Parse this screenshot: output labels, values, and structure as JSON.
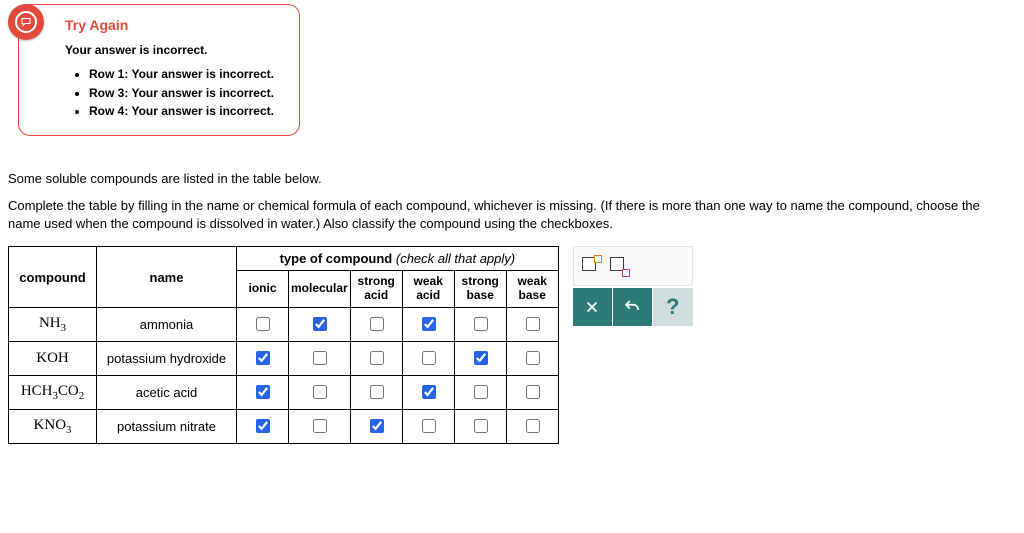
{
  "feedback": {
    "title": "Try Again",
    "subtitle": "Your answer is incorrect.",
    "items": [
      "Row 1: Your answer is incorrect.",
      "Row 3: Your answer is incorrect.",
      "Row 4: Your answer is incorrect."
    ]
  },
  "instructions": {
    "p1": "Some soluble compounds are listed in the table below.",
    "p2": "Complete the table by filling in the name or chemical formula of each compound, whichever is missing. (If there is more than one way to name the compound, choose the name used when the compound is dissolved in water.) Also classify the compound using the checkboxes."
  },
  "table": {
    "headers": {
      "compound": "compound",
      "name": "name",
      "type_group": "type of compound",
      "type_group_hint": "(check all that apply)",
      "cols": {
        "ionic": "ionic",
        "molecular": "molecular",
        "strong_acid_1": "strong",
        "strong_acid_2": "acid",
        "weak_acid_1": "weak",
        "weak_acid_2": "acid",
        "strong_base_1": "strong",
        "strong_base_2": "base",
        "weak_base_1": "weak",
        "weak_base_2": "base"
      }
    },
    "rows": [
      {
        "formula_html": "NH<sub>3</sub>",
        "name": "ammonia",
        "checks": {
          "ionic": false,
          "molecular": true,
          "strong_acid": false,
          "weak_acid": true,
          "strong_base": false,
          "weak_base": false
        }
      },
      {
        "formula_html": "KOH",
        "name": "potassium hydroxide",
        "checks": {
          "ionic": true,
          "molecular": false,
          "strong_acid": false,
          "weak_acid": false,
          "strong_base": true,
          "weak_base": false
        }
      },
      {
        "formula_html": "HCH<sub>3</sub>CO<sub>2</sub>",
        "name": "acetic acid",
        "checks": {
          "ionic": true,
          "molecular": false,
          "strong_acid": false,
          "weak_acid": true,
          "strong_base": false,
          "weak_base": false
        }
      },
      {
        "formula_html": "KNO<sub>3</sub>",
        "name": "potassium nitrate",
        "checks": {
          "ionic": true,
          "molecular": false,
          "strong_acid": true,
          "weak_acid": false,
          "strong_base": false,
          "weak_base": false
        }
      }
    ]
  },
  "toolbar": {
    "close_label": "✕",
    "help_label": "?"
  }
}
